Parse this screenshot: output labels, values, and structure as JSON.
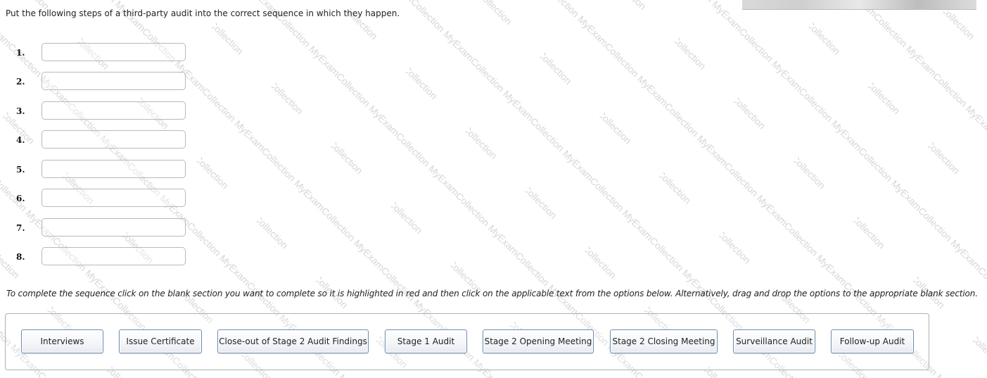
{
  "question": "Put the following steps of a third-party audit into the correct sequence in which they happen.",
  "slots": [
    {
      "number": "1.",
      "value": ""
    },
    {
      "number": "2.",
      "value": ""
    },
    {
      "number": "3.",
      "value": ""
    },
    {
      "number": "4.",
      "value": ""
    },
    {
      "number": "5.",
      "value": ""
    },
    {
      "number": "6.",
      "value": ""
    },
    {
      "number": "7.",
      "value": ""
    },
    {
      "number": "8.",
      "value": ""
    }
  ],
  "instructions": "To complete the sequence click on the blank section you want to complete so it is highlighted in red and then click on the applicable text from the options below. Alternatively, drag and drop the options to the appropriate blank section.",
  "options": [
    "Interviews",
    "Issue Certificate",
    "Close-out of Stage 2 Audit Findings",
    "Stage 1 Audit",
    "Stage 2 Opening Meeting",
    "Stage 2 Closing Meeting",
    "Surveillance Audit",
    "Follow-up Audit"
  ],
  "watermark": "MyExamCollection",
  "colors": {
    "button_border": "#6f8fb5",
    "slot_border": "#b9b9b9",
    "watermark": "#c8c8c8"
  }
}
